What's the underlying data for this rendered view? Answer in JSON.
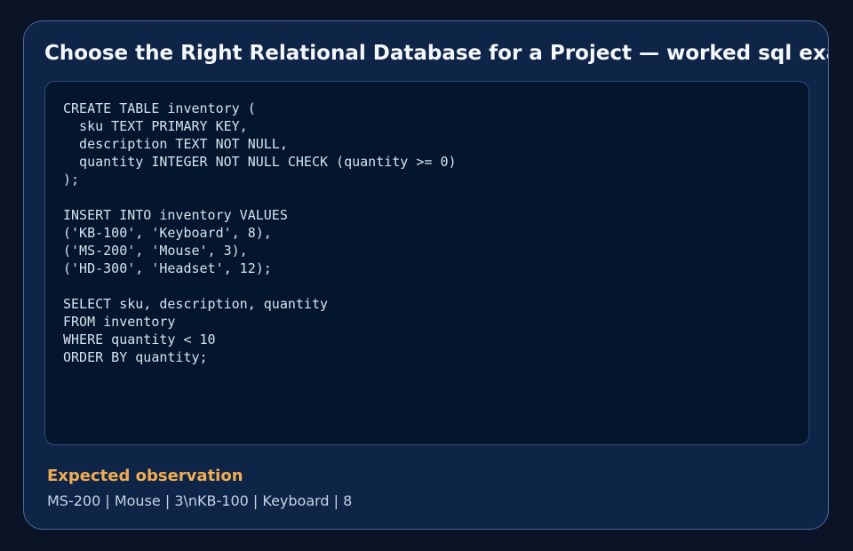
{
  "header": {
    "title": "Choose the Right Relational Database for a Project — worked sql example"
  },
  "code": {
    "language": "sql",
    "content": "CREATE TABLE inventory (\n  sku TEXT PRIMARY KEY,\n  description TEXT NOT NULL,\n  quantity INTEGER NOT NULL CHECK (quantity >= 0)\n);\n\nINSERT INTO inventory VALUES\n('KB-100', 'Keyboard', 8),\n('MS-200', 'Mouse', 3),\n('HD-300', 'Headset', 12);\n\nSELECT sku, description, quantity\nFROM inventory\nWHERE quantity < 10\nORDER BY quantity;"
  },
  "observation": {
    "heading": "Expected observation",
    "text": "MS-200 | Mouse | 3\\nKB-100 | Keyboard | 8"
  },
  "colors": {
    "page_background": "#0a1426",
    "card_background": "#0f2547",
    "card_border": "#4a6a98",
    "code_background": "#03162e",
    "title_text": "#f4f7fb",
    "code_text": "#d8e2ee",
    "observation_heading": "#f0ad55",
    "observation_text": "#c5d2e4"
  }
}
